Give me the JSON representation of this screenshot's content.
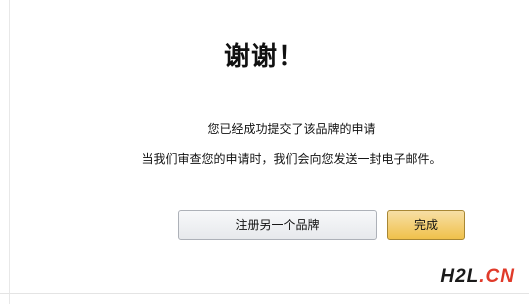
{
  "dialog": {
    "title": "谢谢！",
    "message_line_1": "您已经成功提交了该品牌的申请",
    "message_line_2": "当我们审查您的申请时，我们会向您发送一封电子邮件。"
  },
  "buttons": {
    "register_another_label": "注册另一个品牌",
    "done_label": "完成"
  },
  "watermark": {
    "text_main": "H2L",
    "text_dot": ".",
    "text_tld": "CN"
  },
  "colors": {
    "primary_button": "#f0c14b",
    "secondary_button": "#e7e9ec",
    "watermark_accent": "#e03a2a"
  }
}
